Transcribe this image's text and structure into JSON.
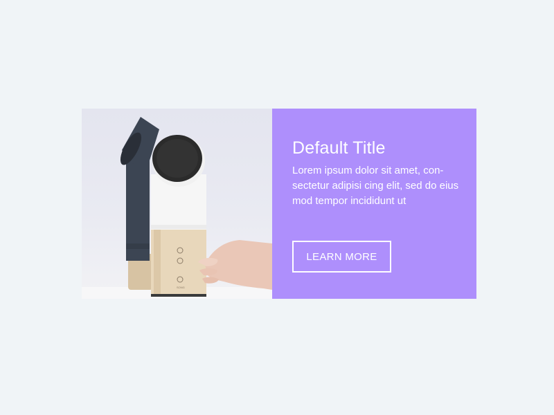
{
  "card": {
    "title": "Default Title",
    "body": "Lorem ipsum dolor sit amet, con-sectetur adipisi cing elit, sed do eius mod tempor incididunt ut",
    "cta_label": "LEARN MORE",
    "panel_color": "#ae8ffc"
  },
  "image": {
    "subject": "two-speaker-product-photo",
    "speaker_label": "SONG"
  }
}
